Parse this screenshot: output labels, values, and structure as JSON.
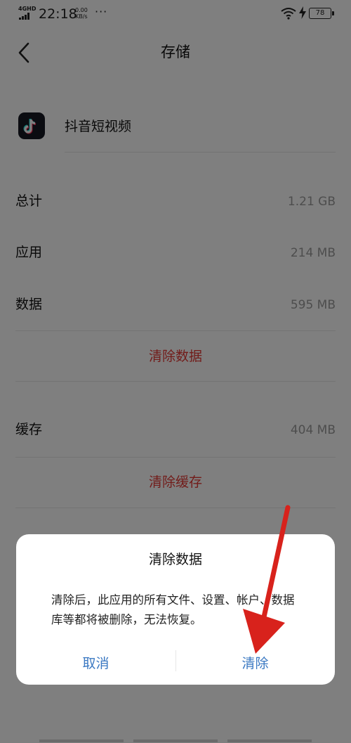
{
  "status_bar": {
    "network": "4GHD",
    "time": "22:18",
    "speed_value": "0.00",
    "speed_unit": "KB/s",
    "more": "···",
    "battery": "78"
  },
  "header": {
    "title": "存储"
  },
  "app": {
    "name": "抖音短视频",
    "icon": "tiktok-note-icon"
  },
  "storage": {
    "total_label": "总计",
    "total_value": "1.21 GB",
    "app_label": "应用",
    "app_value": "214 MB",
    "data_label": "数据",
    "data_value": "595 MB",
    "clear_data": "清除数据",
    "cache_label": "缓存",
    "cache_value": "404 MB",
    "clear_cache": "清除缓存"
  },
  "dialog": {
    "title": "清除数据",
    "message": "清除后，此应用的所有文件、设置、帐户、数据库等都将被删除，无法恢复。",
    "cancel": "取消",
    "confirm": "清除"
  },
  "colors": {
    "destructive": "#e53935",
    "dialog_button": "#3a78c2",
    "annotation": "#d8221c"
  }
}
